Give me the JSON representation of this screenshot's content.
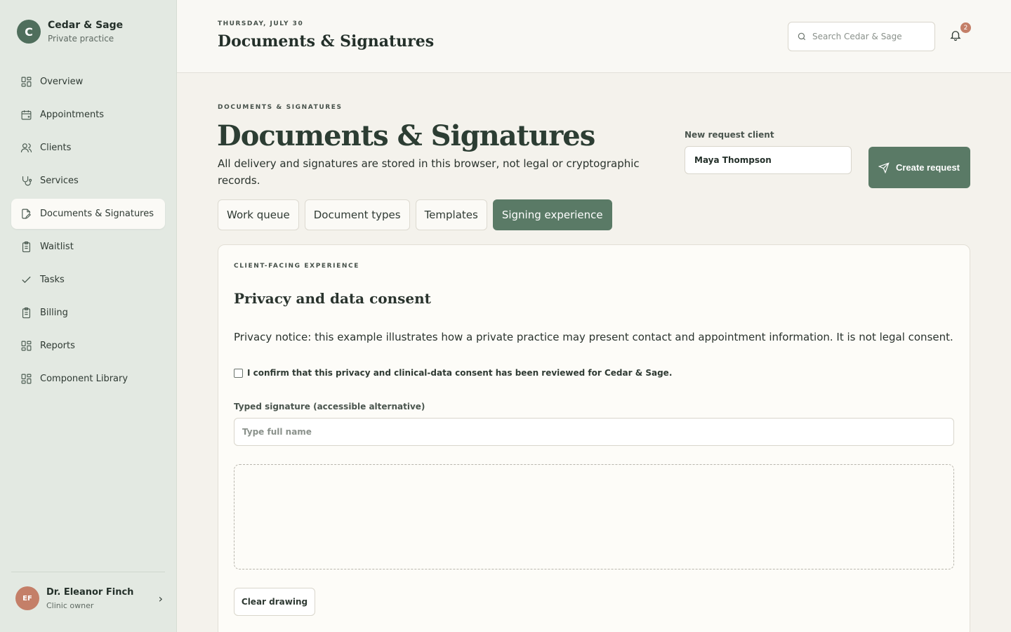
{
  "brand": {
    "initial": "C",
    "name": "Cedar & Sage",
    "subtitle": "Private practice"
  },
  "sidebar": {
    "items": [
      {
        "label": "Overview",
        "icon": "grid-icon"
      },
      {
        "label": "Appointments",
        "icon": "calendar-icon"
      },
      {
        "label": "Clients",
        "icon": "users-icon"
      },
      {
        "label": "Services",
        "icon": "stethoscope-icon"
      },
      {
        "label": "Documents & Signatures",
        "icon": "document-sign-icon",
        "active": true
      },
      {
        "label": "Waitlist",
        "icon": "clipboard-icon"
      },
      {
        "label": "Tasks",
        "icon": "check-icon"
      },
      {
        "label": "Billing",
        "icon": "clipboard-icon"
      },
      {
        "label": "Reports",
        "icon": "grid-icon"
      },
      {
        "label": "Component Library",
        "icon": "grid-icon"
      }
    ]
  },
  "user": {
    "initials": "EF",
    "name": "Dr. Eleanor Finch",
    "role": "Clinic owner"
  },
  "topbar": {
    "date": "THURSDAY, JULY 30",
    "title": "Documents & Signatures",
    "search_placeholder": "Search Cedar & Sage",
    "notification_count": "2"
  },
  "main": {
    "eyebrow": "DOCUMENTS & SIGNATURES",
    "title": "Documents & Signatures",
    "description": "All delivery and signatures are stored in this browser, not legal or cryptographic records.",
    "client_label": "New request client",
    "client_value": "Maya Thompson",
    "create_label": "Create request",
    "tabs": [
      {
        "label": "Work queue"
      },
      {
        "label": "Document types"
      },
      {
        "label": "Templates"
      },
      {
        "label": "Signing experience",
        "active": true
      }
    ]
  },
  "card": {
    "eyebrow": "CLIENT-FACING EXPERIENCE",
    "title": "Privacy and data consent",
    "notice": "Privacy notice: this example illustrates how a private practice may present contact and appointment information. It is not legal consent.",
    "confirm_label": "I confirm that this privacy and clinical-data consent has been reviewed for Cedar & Sage.",
    "confirm_checked": false,
    "signature_label": "Typed signature (accessible alternative)",
    "signature_placeholder": "Type full name",
    "clear_label": "Clear drawing"
  },
  "colors": {
    "accent": "#5a7a66",
    "sidebar_bg": "#e3e9e2",
    "page_bg": "#f4f2ec",
    "badge": "#c47f68"
  }
}
